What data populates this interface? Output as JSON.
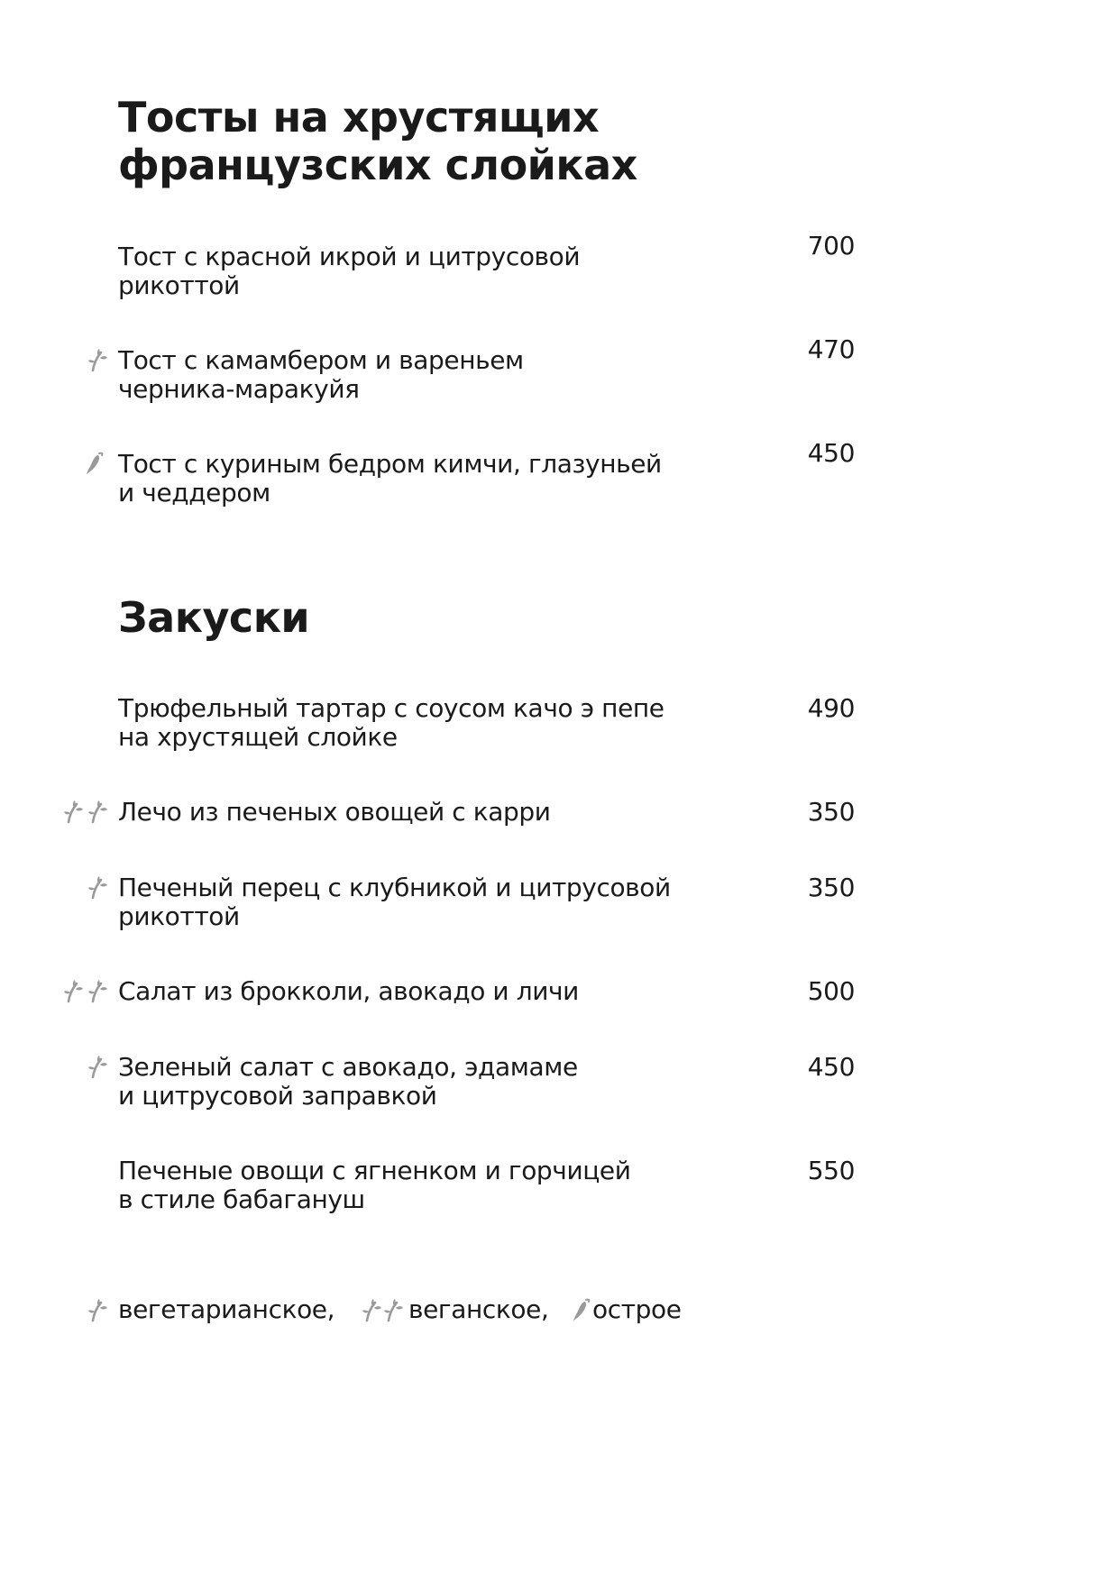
{
  "sections": [
    {
      "title_lines": [
        "Тосты на хрустящих",
        "французских слойках"
      ],
      "items": [
        {
          "lines": [
            "Тост с красной икрой и цитрусовой",
            "рикоттой"
          ],
          "price": "700",
          "icons": []
        },
        {
          "lines": [
            "Тост  с камамбером и вареньем",
            "черника-маракуйя"
          ],
          "price": "470",
          "icons": [
            "vegetarian"
          ]
        },
        {
          "lines": [
            "Тост  с куриным бедром кимчи, глазуньей",
            "и чеддером"
          ],
          "price": "450",
          "icons": [
            "spicy"
          ]
        }
      ]
    },
    {
      "title_lines": [
        "Закуски"
      ],
      "items": [
        {
          "lines": [
            "Трюфельный тартар с соусом качо э пепе",
            "на хрустящей слойке"
          ],
          "price": "490",
          "icons": []
        },
        {
          "lines": [
            "Лечо из печеных овощей с карри"
          ],
          "price": "350",
          "icons": [
            "vegan"
          ]
        },
        {
          "lines": [
            "Печеный перец с клубникой и цитрусовой",
            "рикоттой"
          ],
          "price": "350",
          "icons": [
            "vegetarian"
          ]
        },
        {
          "lines": [
            "Салат из брокколи, авокадо и личи"
          ],
          "price": "500",
          "icons": [
            "vegan"
          ]
        },
        {
          "lines": [
            "Зеленый салат с авокадо, эдамаме",
            "и цитрусовой заправкой"
          ],
          "price": "450",
          "icons": [
            "vegetarian"
          ]
        },
        {
          "lines": [
            "Печеные овощи с ягненком и горчицей",
            "в стиле бабагануш"
          ],
          "price": "550",
          "icons": []
        }
      ]
    }
  ],
  "legend": {
    "vegetarian": "вегетарианское,",
    "vegan": "веганское,",
    "spicy": "острое"
  },
  "icons": {
    "vegetarian": "sprout-icon",
    "vegan": "double-sprout-icon",
    "spicy": "chili-pepper-icon"
  },
  "colors": {
    "text": "#1a1a1a",
    "icon": "#9a9a9a"
  }
}
